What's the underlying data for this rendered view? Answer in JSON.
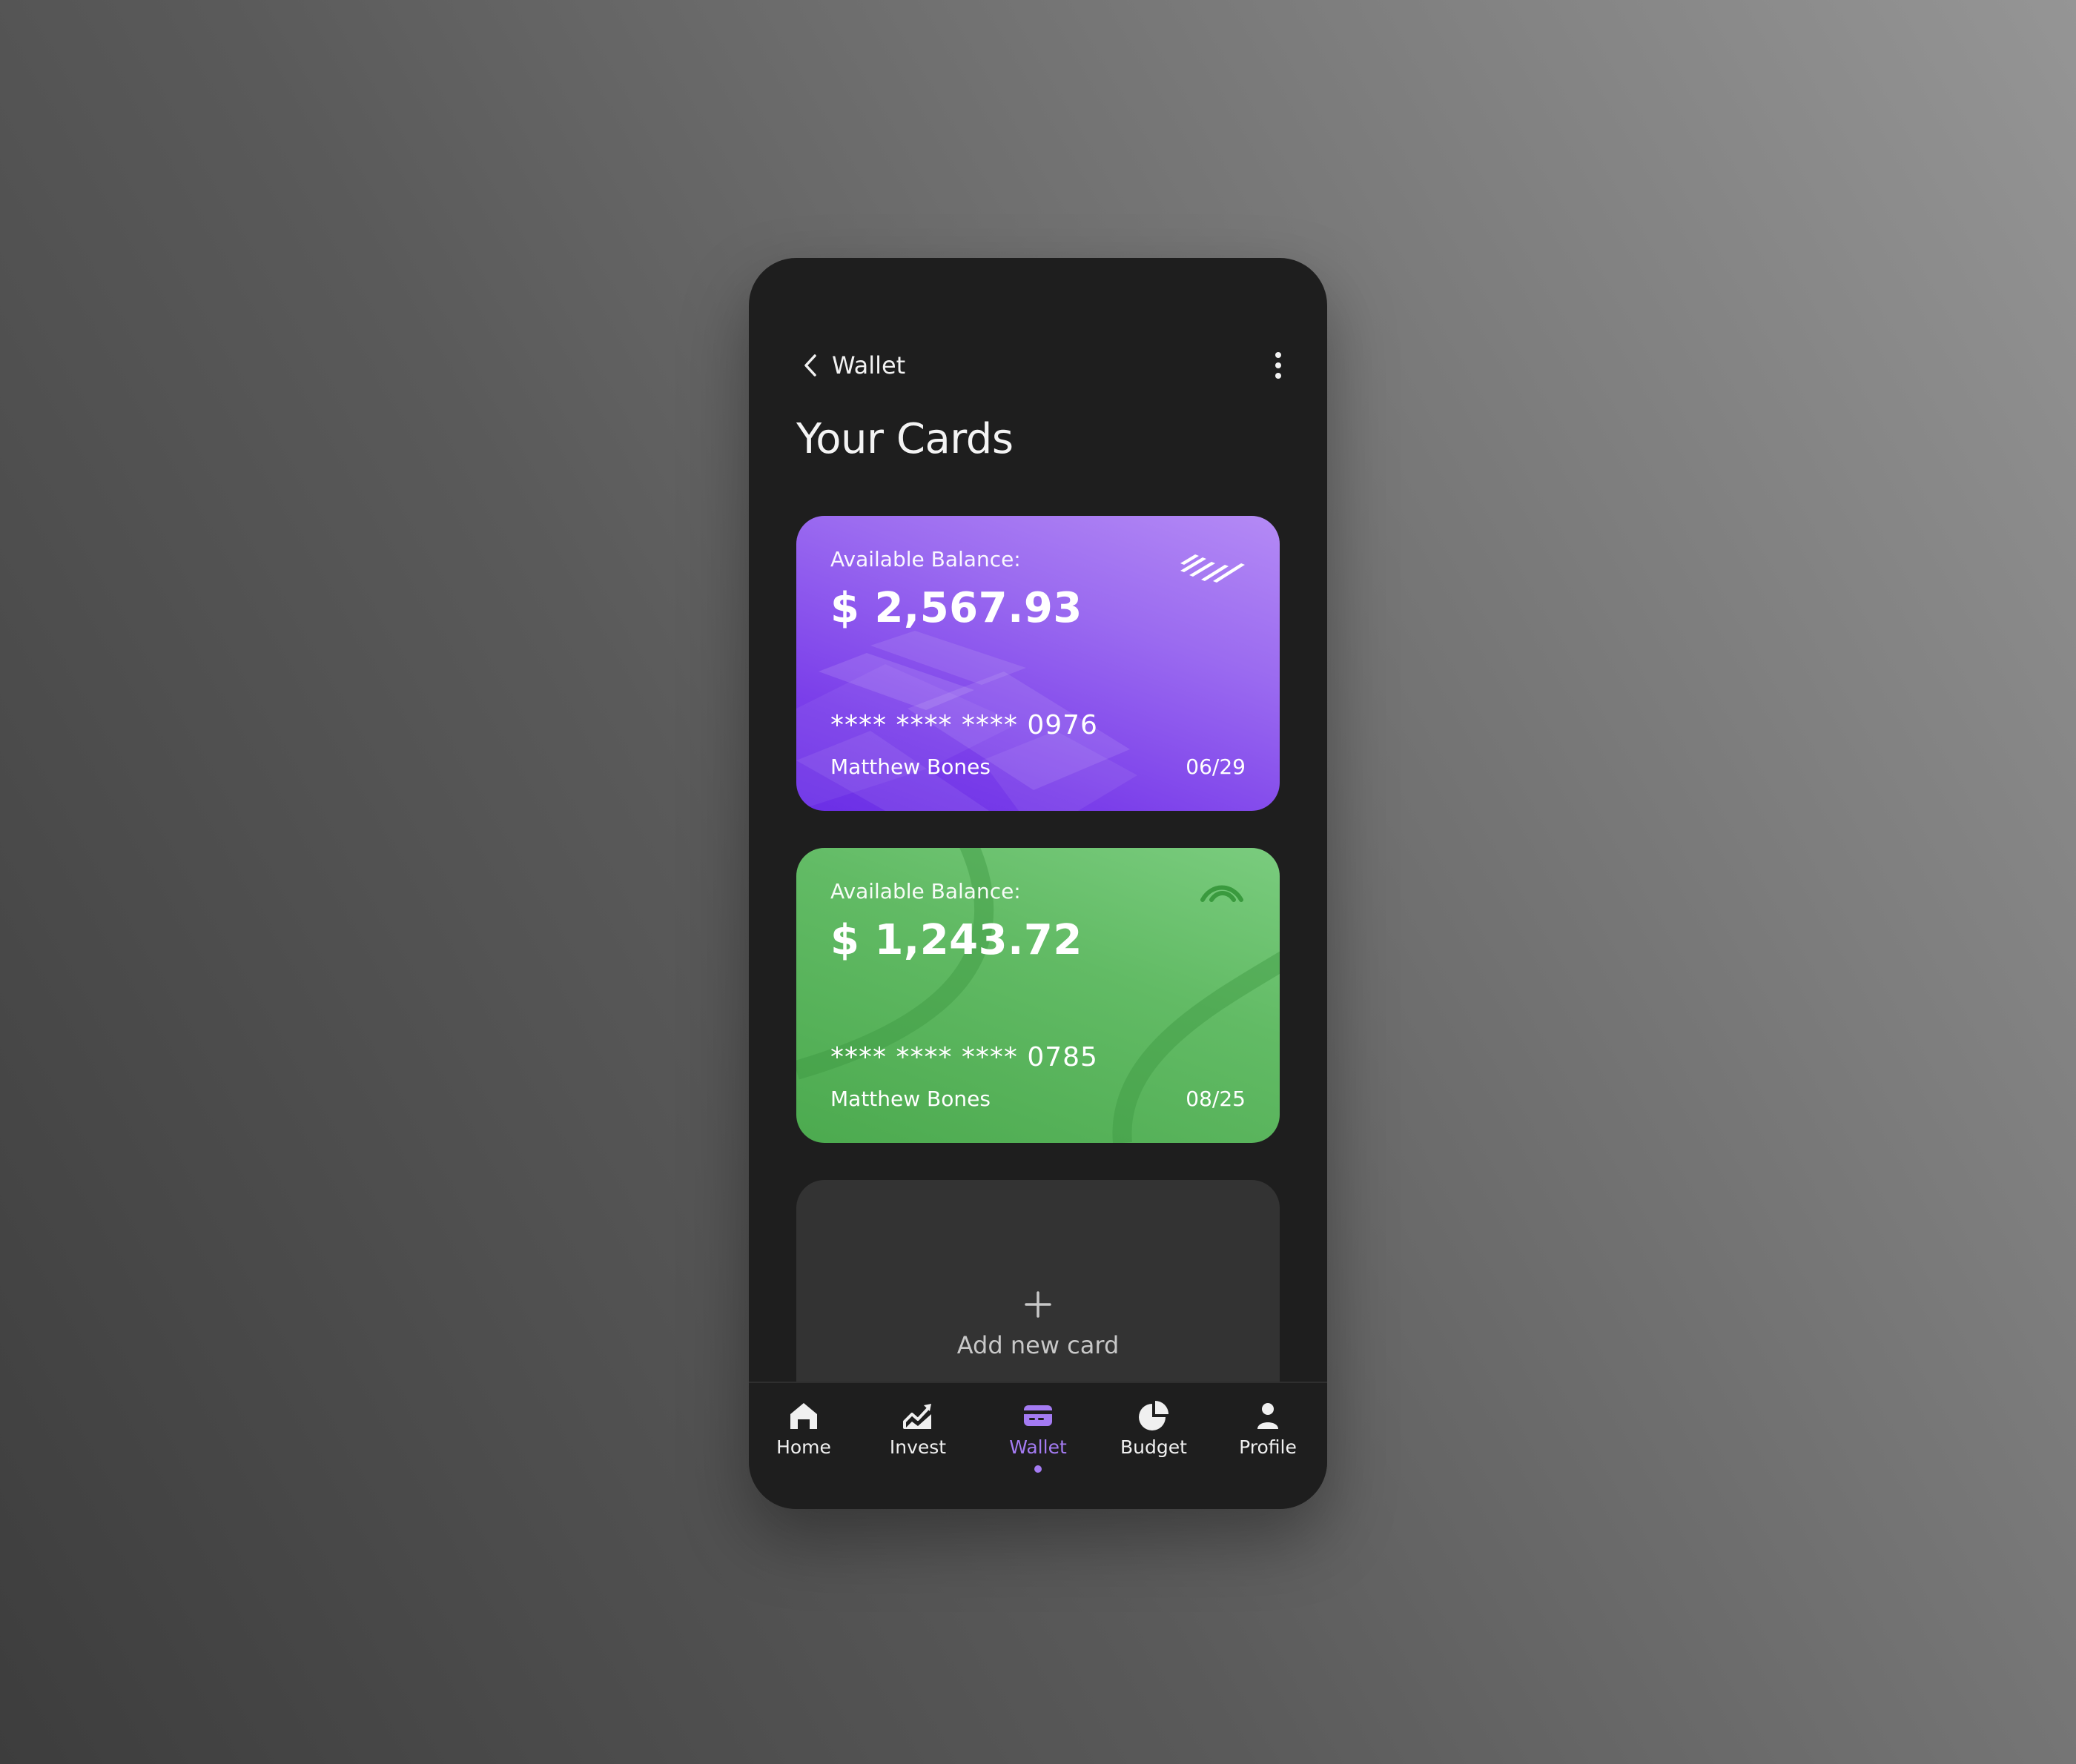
{
  "header": {
    "title": "Wallet",
    "back_icon": "chevron-left-icon",
    "more_icon": "more-vertical-icon"
  },
  "page_title": "Your Cards",
  "cards": [
    {
      "balance_label": "Available Balance:",
      "balance": "$ 2,567.93",
      "number": "**** **** **** 0976",
      "holder": "Matthew Bones",
      "expiry": "06/29",
      "color": "#8b5cf6",
      "logo_icon": "bank-flag-icon"
    },
    {
      "balance_label": "Available Balance:",
      "balance": "$ 1,243.72",
      "number": "**** **** **** 0785",
      "holder": "Matthew Bones",
      "expiry": "08/25",
      "color": "#5cb85f",
      "logo_icon": "arc-logo-icon"
    }
  ],
  "add_card": {
    "label": "Add new card",
    "icon": "plus-icon"
  },
  "nav": {
    "items": [
      {
        "label": "Home",
        "icon": "home-icon"
      },
      {
        "label": "Invest",
        "icon": "chart-area-icon"
      },
      {
        "label": "Wallet",
        "icon": "wallet-card-icon",
        "active": true
      },
      {
        "label": "Budget",
        "icon": "pie-chart-icon"
      },
      {
        "label": "Profile",
        "icon": "user-icon"
      }
    ],
    "accent_color": "#a47bf2"
  }
}
